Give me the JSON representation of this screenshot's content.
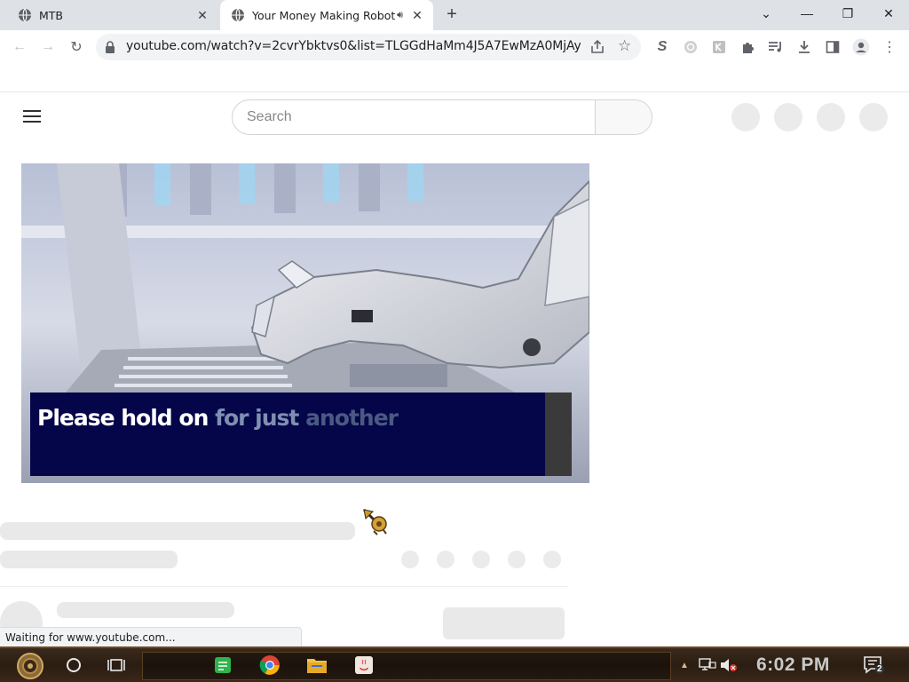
{
  "browser": {
    "tabs": [
      {
        "title": "MTB",
        "active": false
      },
      {
        "title": "Your Money Making Robot",
        "active": true,
        "audio": true
      }
    ],
    "url": "youtube.com/watch?v=2cvrYbktvs0&list=TLGGdHaMm4J5A7EwMzA0MjAy...",
    "status_text": "Waiting for www.youtube.com..."
  },
  "youtube": {
    "search_placeholder": "Search"
  },
  "video": {
    "caption": {
      "w1": "Please hold on",
      "w2": "for just",
      "w3": "another"
    }
  },
  "taskbar": {
    "clock": "6:02 PM",
    "notification_count": "2"
  },
  "colors": {
    "tabstrip": "#dee1e6",
    "caption_bg": "#05064a",
    "taskbar": "#2a1d12"
  }
}
